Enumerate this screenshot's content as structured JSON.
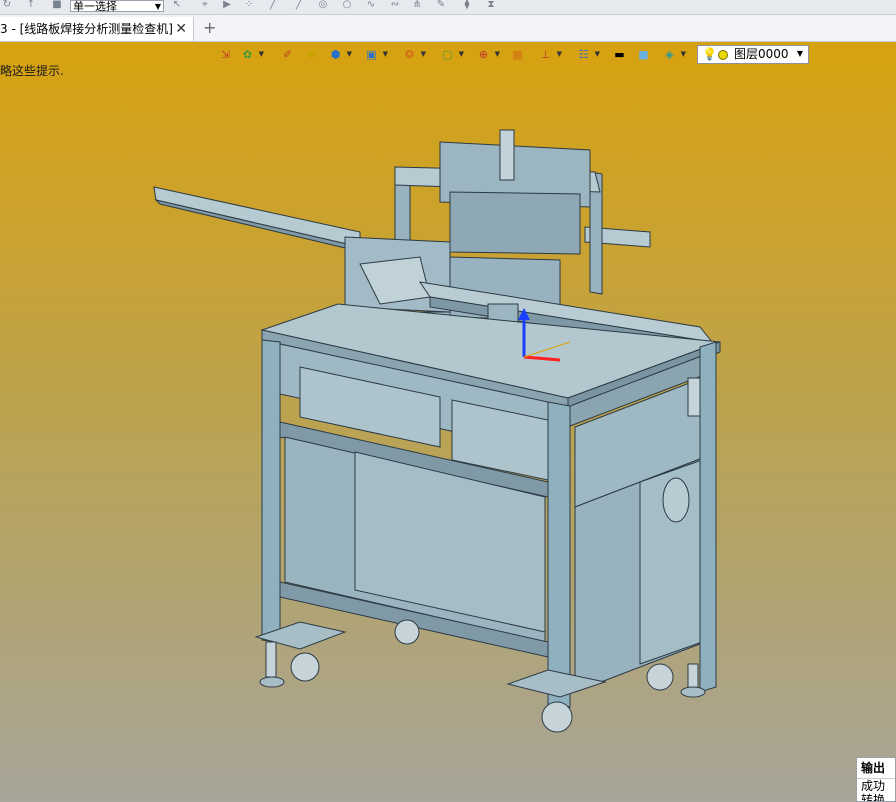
{
  "topbar": {
    "select_mode": "单一选择"
  },
  "tabs": [
    {
      "label": "3 - [线路板焊接分析测量检查机]"
    }
  ],
  "viewport": {
    "hint": "略这些提示."
  },
  "layer": {
    "name": "图层0000"
  },
  "output_panel": {
    "title": "输出",
    "line1": "成功",
    "line2": "转换"
  },
  "icons": [
    "tool-icon",
    "cube-icon",
    "view-icon",
    "render-icon",
    "layer-icon"
  ],
  "colors": {
    "bg_top": "#d7a210",
    "bg_bottom": "#a8a59a",
    "machine_frame": "#8fb0bf",
    "machine_panel": "#a9c2cc"
  }
}
